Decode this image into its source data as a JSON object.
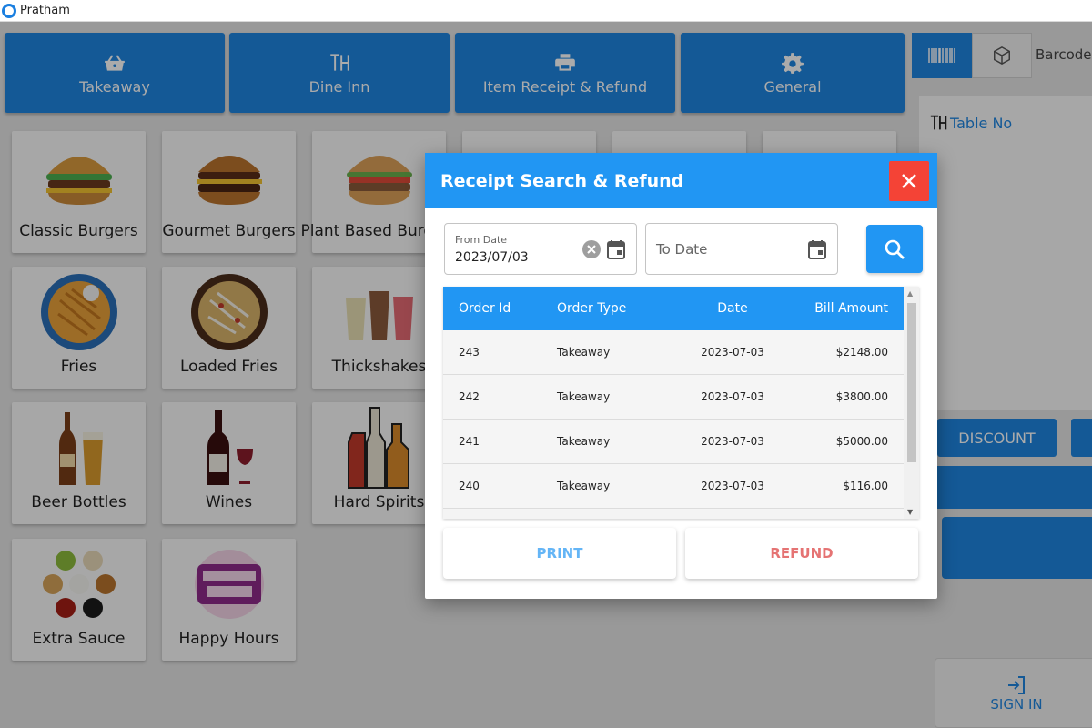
{
  "window": {
    "title": "Pratham"
  },
  "top_buttons": [
    {
      "label": "Takeaway",
      "icon": "basket-icon"
    },
    {
      "label": "Dine Inn",
      "icon": "table-icon"
    },
    {
      "label": "Item Receipt & Refund",
      "icon": "printer-icon"
    },
    {
      "label": "General",
      "icon": "gear-icon"
    }
  ],
  "categories": [
    {
      "label": "Classic Burgers"
    },
    {
      "label": "Gourmet Burgers"
    },
    {
      "label": "Plant Based Burgers"
    },
    {
      "label": "Fries"
    },
    {
      "label": "Loaded Fries"
    },
    {
      "label": "Thickshakes"
    },
    {
      "label": "Beer Bottles"
    },
    {
      "label": "Wines"
    },
    {
      "label": "Hard Spirits"
    },
    {
      "label": "Extra Sauce"
    },
    {
      "label": "Happy Hours"
    }
  ],
  "right_panel": {
    "barcode_label": "Barcode",
    "table_no_label": "Table No",
    "discount_label": "DISCOUNT",
    "signin_label": "SIGN IN"
  },
  "dialog": {
    "title": "Receipt Search & Refund",
    "from_date": {
      "label": "From Date",
      "value": "2023/07/03"
    },
    "to_date": {
      "placeholder": "To Date"
    },
    "table": {
      "headers": [
        "Order Id",
        "Order Type",
        "Date",
        "Bill Amount"
      ],
      "rows": [
        [
          "243",
          "Takeaway",
          "2023-07-03",
          "$2148.00"
        ],
        [
          "242",
          "Takeaway",
          "2023-07-03",
          "$3800.00"
        ],
        [
          "241",
          "Takeaway",
          "2023-07-03",
          "$5000.00"
        ],
        [
          "240",
          "Takeaway",
          "2023-07-03",
          "$116.00"
        ]
      ]
    },
    "print_label": "PRINT",
    "refund_label": "REFUND"
  },
  "colors": {
    "primary": "#2196f3",
    "close": "#f44336",
    "print_text": "#64b5f6",
    "refund_text": "#e57373"
  }
}
